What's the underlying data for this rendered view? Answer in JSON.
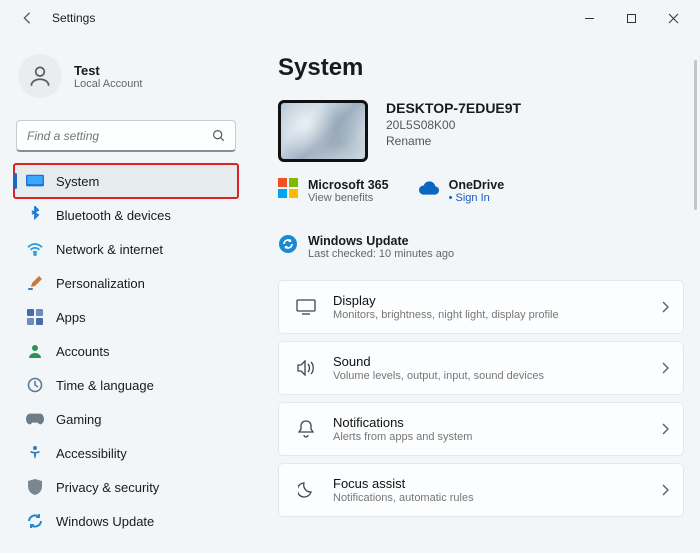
{
  "window": {
    "title": "Settings"
  },
  "user": {
    "name": "Test",
    "subtitle": "Local Account"
  },
  "search": {
    "placeholder": "Find a setting"
  },
  "sidebar": {
    "items": [
      {
        "label": "System",
        "icon": "monitor-icon",
        "active": true
      },
      {
        "label": "Bluetooth & devices",
        "icon": "bluetooth-icon"
      },
      {
        "label": "Network & internet",
        "icon": "wifi-icon"
      },
      {
        "label": "Personalization",
        "icon": "brush-icon"
      },
      {
        "label": "Apps",
        "icon": "apps-icon"
      },
      {
        "label": "Accounts",
        "icon": "person-icon"
      },
      {
        "label": "Time & language",
        "icon": "clock-icon"
      },
      {
        "label": "Gaming",
        "icon": "gamepad-icon"
      },
      {
        "label": "Accessibility",
        "icon": "accessibility-icon"
      },
      {
        "label": "Privacy & security",
        "icon": "shield-icon"
      },
      {
        "label": "Windows Update",
        "icon": "update-icon"
      }
    ]
  },
  "page": {
    "title": "System"
  },
  "device": {
    "name": "DESKTOP-7EDUE9T",
    "model": "20L5S08K00",
    "rename": "Rename"
  },
  "services": {
    "m365": {
      "title": "Microsoft 365",
      "sub": "View benefits"
    },
    "onedrive": {
      "title": "OneDrive",
      "sub": "Sign In",
      "bullet": "•"
    },
    "update": {
      "title": "Windows Update",
      "sub": "Last checked: 10 minutes ago"
    }
  },
  "cards": [
    {
      "title": "Display",
      "sub": "Monitors, brightness, night light, display profile"
    },
    {
      "title": "Sound",
      "sub": "Volume levels, output, input, sound devices"
    },
    {
      "title": "Notifications",
      "sub": "Alerts from apps and system"
    },
    {
      "title": "Focus assist",
      "sub": "Notifications, automatic rules"
    }
  ]
}
